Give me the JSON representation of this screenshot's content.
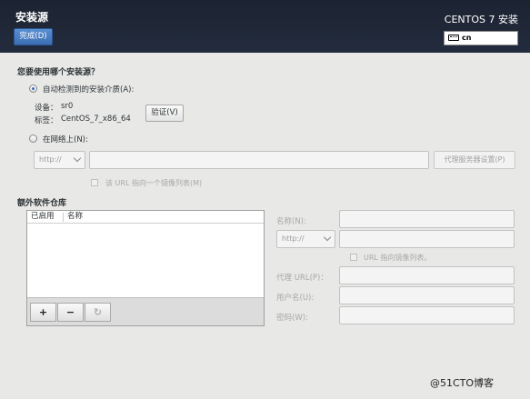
{
  "header": {
    "title": "安装源",
    "done_label": "完成(D)",
    "product": "CENTOS 7 安装",
    "keyboard_layout": "cn"
  },
  "source": {
    "question": "您要使用哪个安装源？",
    "auto_detect_label": "自动检测到的安装介质(A):",
    "device_label": "设备：",
    "device_value": "sr0",
    "tag_label": "标签：",
    "tag_value": "CentOS_7_x86_64",
    "verify_label": "验证(V)",
    "network_label": "在网络上(N):",
    "protocol": "http://",
    "url_value": "",
    "proxy_button": "代理服务器设置(P)",
    "mirror_label": "该 URL 指向一个镜像列表(M)"
  },
  "repos": {
    "title": "额外软件仓库",
    "columns": [
      "已启用",
      "名称"
    ],
    "add": "+",
    "remove": "−",
    "refresh": "↻"
  },
  "repo_detail": {
    "name_label": "名称(N):",
    "protocol": "http://",
    "mirror_label": "URL 指向镜像列表。",
    "proxy_url_label": "代理 URL(P)：",
    "username_label": "用户名(U):",
    "password_label": "密码(W):"
  },
  "watermark": "@51CTO博客"
}
